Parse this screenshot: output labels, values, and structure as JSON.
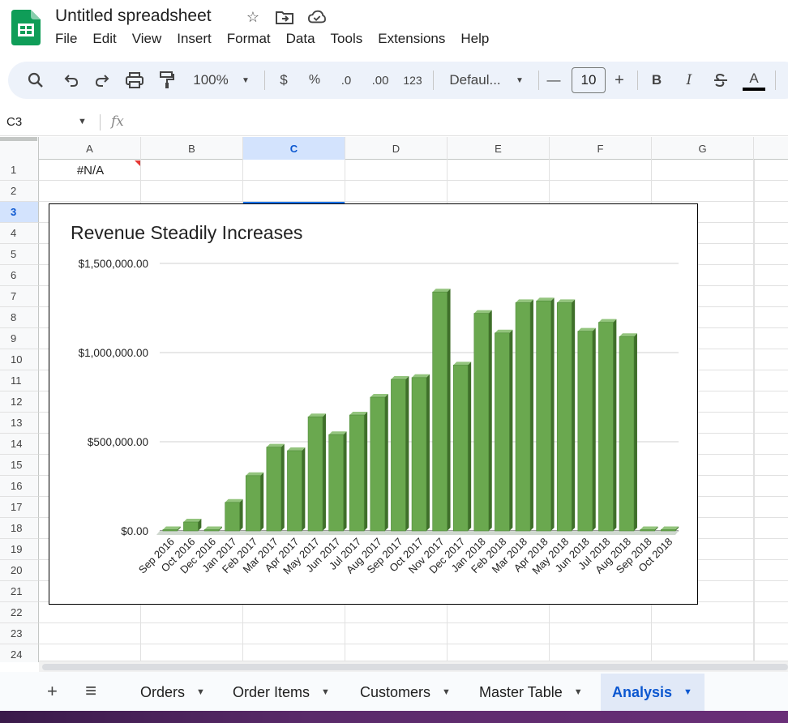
{
  "document": {
    "title": "Untitled spreadsheet"
  },
  "menu": [
    "File",
    "Edit",
    "View",
    "Insert",
    "Format",
    "Data",
    "Tools",
    "Extensions",
    "Help"
  ],
  "toolbar": {
    "zoom": "100%",
    "currency": "$",
    "percent": "%",
    "decrease_decimal": ".0",
    "increase_decimal": ".00",
    "number_format": "123",
    "font": "Defaul...",
    "font_size": "10",
    "minus": "—",
    "plus": "+",
    "bold": "B",
    "italic": "I",
    "text_color": "A"
  },
  "formula_bar": {
    "name_box": "C3",
    "fx": "fx"
  },
  "grid": {
    "columns": [
      "A",
      "B",
      "C",
      "D",
      "E",
      "F",
      "G"
    ],
    "selected_column": "C",
    "rows": [
      "1",
      "2",
      "3",
      "4",
      "5",
      "6",
      "7",
      "8",
      "9",
      "10",
      "11",
      "12",
      "13",
      "14",
      "15",
      "16",
      "17",
      "18",
      "19",
      "20",
      "21",
      "22",
      "23",
      "24"
    ],
    "selected_row": "3",
    "cells": {
      "A1": "#N/A"
    }
  },
  "chart_data": {
    "type": "bar",
    "title": "Revenue Steadily Increases",
    "xlabel": "",
    "ylabel": "",
    "ylim": [
      0,
      1500000
    ],
    "y_ticks": [
      "$0.00",
      "$500,000.00",
      "$1,000,000.00",
      "$1,500,000.00"
    ],
    "y_tick_values": [
      0,
      500000,
      1000000,
      1500000
    ],
    "grid": true,
    "bar_color": "#6aa84f",
    "categories": [
      "Sep 2016",
      "Oct 2016",
      "Dec 2016",
      "Jan 2017",
      "Feb 2017",
      "Mar 2017",
      "Apr 2017",
      "May 2017",
      "Jun 2017",
      "Jul 2017",
      "Aug 2017",
      "Sep 2017",
      "Oct 2017",
      "Nov 2017",
      "Dec 2017",
      "Jan 2018",
      "Feb 2018",
      "Mar 2018",
      "Apr 2018",
      "May 2018",
      "Jun 2018",
      "Jul 2018",
      "Aug 2018",
      "Sep 2018",
      "Oct 2018"
    ],
    "values": [
      0,
      50000,
      0,
      160000,
      310000,
      470000,
      450000,
      640000,
      540000,
      650000,
      750000,
      850000,
      860000,
      1340000,
      930000,
      1220000,
      1110000,
      1280000,
      1290000,
      1280000,
      1120000,
      1170000,
      1090000,
      0,
      0
    ]
  },
  "sheets": {
    "tabs": [
      "Orders",
      "Order Items",
      "Customers",
      "Master Table",
      "Analysis"
    ],
    "active": "Analysis",
    "add_label": "+",
    "list_label": "≡"
  },
  "colors": {
    "accent": "#0b57d0",
    "logo_green": "#0f9d58",
    "selection": "#d3e3fd"
  }
}
